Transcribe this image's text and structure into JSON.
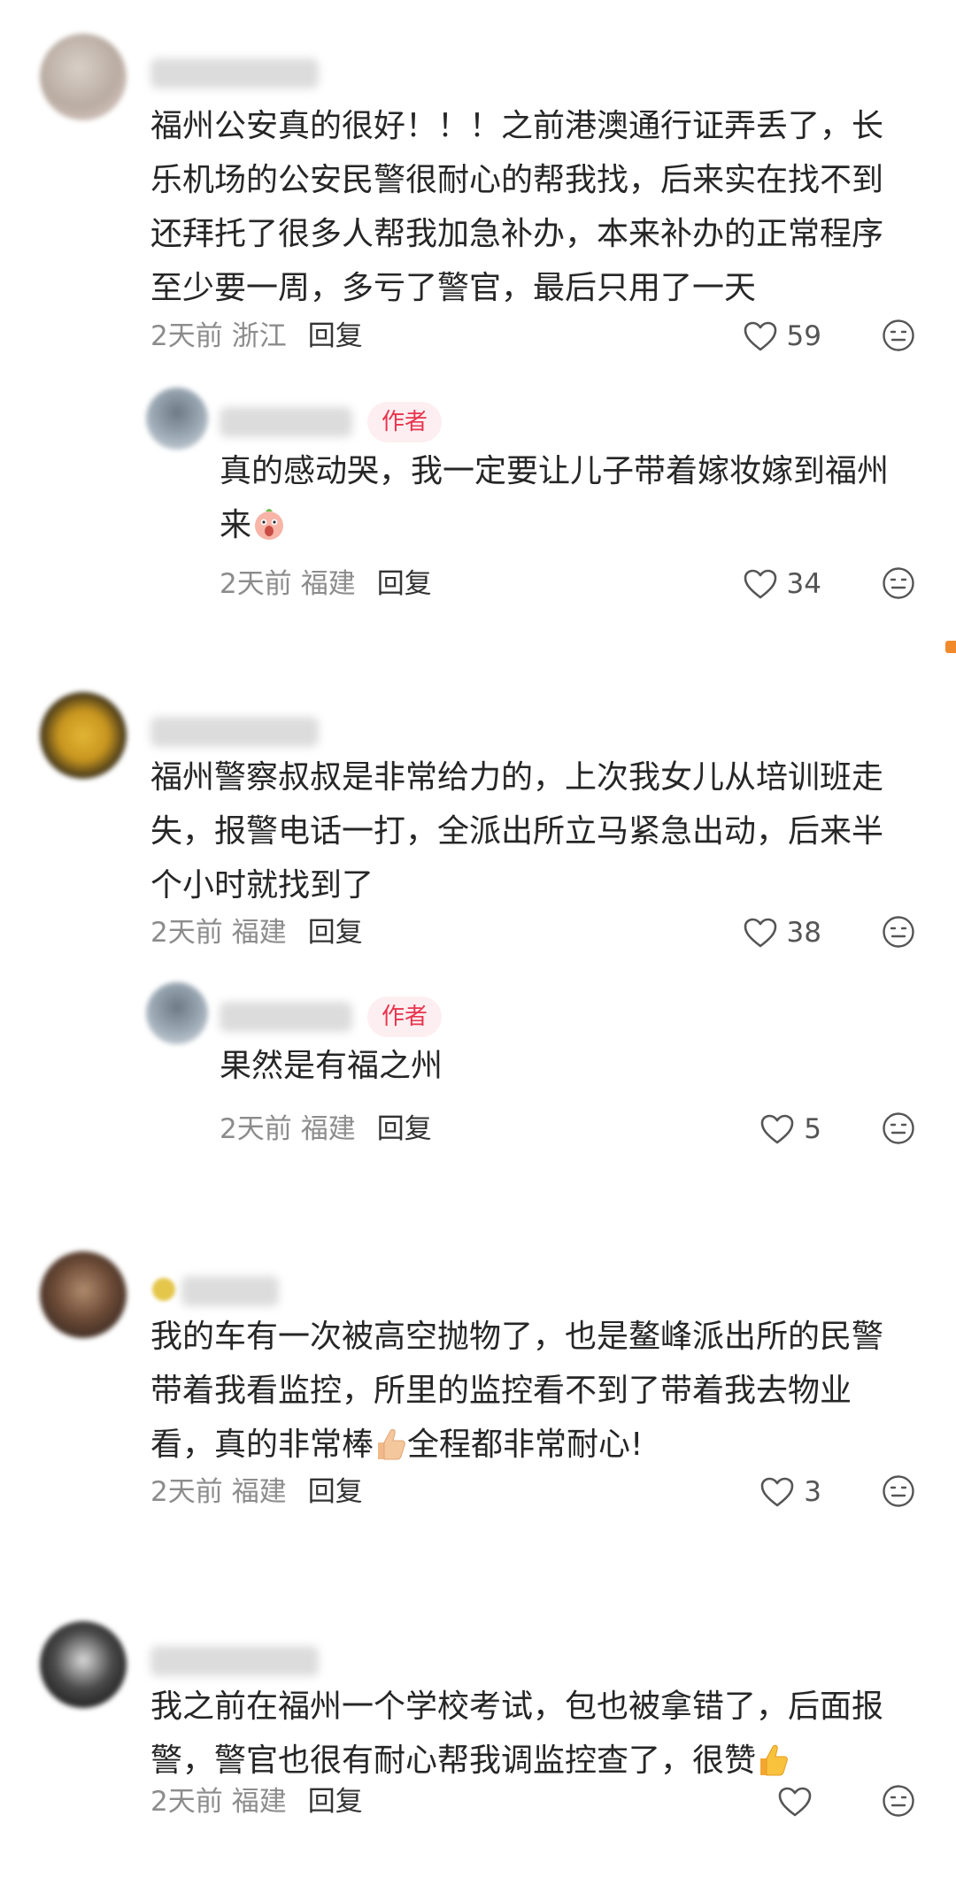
{
  "comments": [
    {
      "text": "福州公安真的很好！！！之前港澳通行证弄丢了，长乐机场的公安民警很耐心的帮我找，后来实在找不到还拜托了很多人帮我加急补办，本来补办的正常程序至少要一周，多亏了警官，最后只用了一天",
      "time": "2天前",
      "location": "浙江",
      "reply_label": "回复",
      "likes": "59",
      "reply": {
        "badge": "作者",
        "text_before": "真的感动哭，我一定要让儿子带着嫁妆嫁到福州来",
        "time": "2天前",
        "location": "福建",
        "reply_label": "回复",
        "likes": "34"
      }
    },
    {
      "text": "福州警察叔叔是非常给力的，上次我女儿从培训班走失，报警电话一打，全派出所立马紧急出动，后来半个小时就找到了",
      "time": "2天前",
      "location": "福建",
      "reply_label": "回复",
      "likes": "38",
      "reply": {
        "badge": "作者",
        "text": "果然是有福之州",
        "time": "2天前",
        "location": "福建",
        "reply_label": "回复",
        "likes": "5"
      }
    },
    {
      "text_before": "我的车有一次被高空抛物了，也是鳌峰派出所的民警带着我看监控，所里的监控看不到了带着我去物业看，真的非常棒",
      "text_after": "全程都非常耐心!",
      "time": "2天前",
      "location": "福建",
      "reply_label": "回复",
      "likes": "3"
    },
    {
      "text": "我之前在福州一个学校考试，包也被拿错了，后面报警，警官也很有耐心帮我调监控查了，很赞",
      "time": "2天前",
      "location": "福建",
      "reply_label": "回复",
      "likes": ""
    }
  ],
  "icons": {
    "like": "heart-outline-icon",
    "dislike": "neutral-face-icon",
    "emoji_pig": "pig-face-emoji",
    "emoji_thumb": "thumbs-up-emoji"
  },
  "colors": {
    "badge_text": "#e8344e",
    "badge_bg": "#fdeff1",
    "meta": "#8c8c8c"
  }
}
